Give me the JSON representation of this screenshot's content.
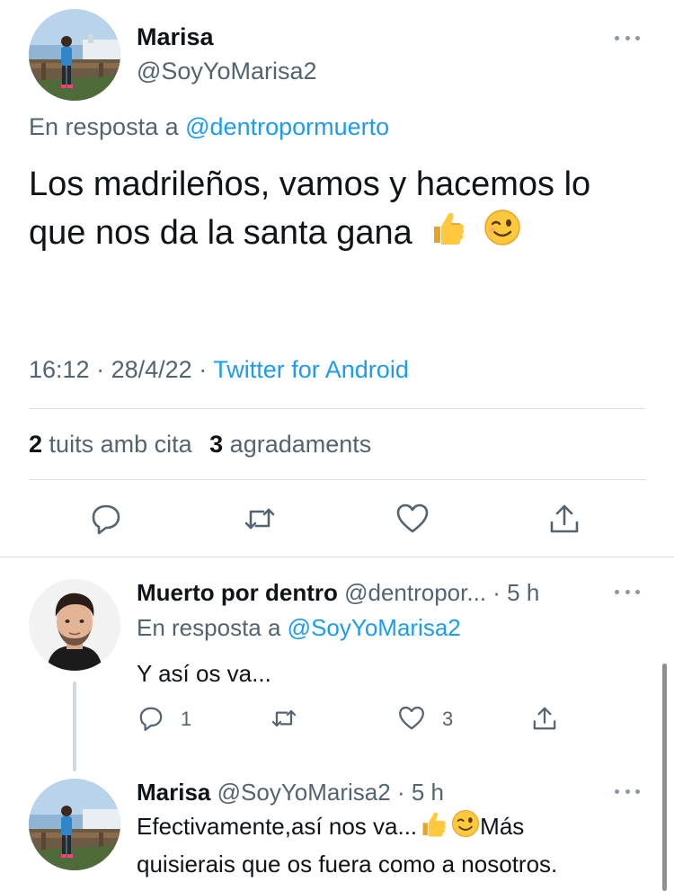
{
  "main_tweet": {
    "author_name": "Marisa",
    "author_handle": "@SoyYoMarisa2",
    "reply_prefix": "En resposta a",
    "reply_to": "@dentropormuerto",
    "text": "Los madrileños, vamos y hacemos lo que nos da la santa gana",
    "time": "16:12",
    "date": "28/4/22",
    "separator": "·",
    "source": "Twitter for Android",
    "quote_count": "2",
    "quote_label": "tuits amb cita",
    "like_count": "3",
    "like_label": "agradaments"
  },
  "icons": {
    "reply": "reply-icon",
    "retweet": "retweet-icon",
    "like": "heart-icon",
    "share": "share-icon",
    "more": "more-icon",
    "thumbs_up": "thumbs-up-emoji",
    "wink": "wink-emoji"
  },
  "colors": {
    "link": "#1d9bf0",
    "muted": "#536471",
    "text": "#0f1419"
  },
  "replies": [
    {
      "author_name": "Muerto por dentro",
      "author_handle": "@dentropor...",
      "age": "· 5 h",
      "reply_prefix": "En resposta a",
      "reply_to": "@SoyYoMarisa2",
      "text": "Y así os va...",
      "reply_count": "1",
      "like_count": "3"
    },
    {
      "author_name": "Marisa",
      "author_handle": "@SoyYoMarisa2",
      "age": "· 5 h",
      "text_part1": "Efectivamente,así nos va...",
      "text_part2": "Más",
      "text_line2": "quisierais que os fuera como a nosotros."
    }
  ]
}
